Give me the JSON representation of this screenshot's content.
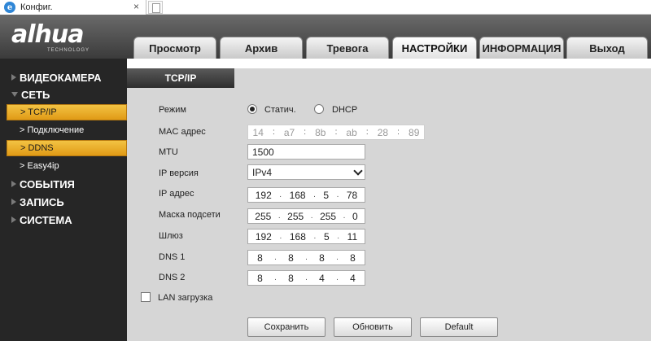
{
  "browser": {
    "tab_title": "Конфиг.",
    "close_glyph": "×"
  },
  "header": {
    "logo": "alhua",
    "logo_sub": "TECHNOLOGY",
    "tabs": [
      "Просмотр",
      "Архив",
      "Тревога",
      "НАСТРОЙКИ",
      "ИНФОРМАЦИЯ",
      "Выход"
    ],
    "active_tab": "НАСТРОЙКИ"
  },
  "sidebar": {
    "items": [
      {
        "label": "ВИДЕОКАМЕРА"
      },
      {
        "label": "СЕТЬ"
      },
      {
        "label": "> TCP/IP"
      },
      {
        "label": "> Подключение"
      },
      {
        "label": "> DDNS"
      },
      {
        "label": "> Easy4ip"
      },
      {
        "label": "СОБЫТИЯ"
      },
      {
        "label": "ЗАПИСЬ"
      },
      {
        "label": "СИСТЕМА"
      }
    ]
  },
  "content": {
    "tab": "TCP/IP",
    "mode": {
      "label": "Режим",
      "static": "Статич.",
      "dhcp": "DHCP",
      "selected": "static"
    },
    "mac": {
      "label": "MAC адрес",
      "octets": [
        "14",
        "a7",
        "8b",
        "ab",
        "28",
        "89"
      ]
    },
    "mtu": {
      "label": "MTU",
      "value": "1500"
    },
    "ip_version": {
      "label": "IP версия",
      "value": "IPv4"
    },
    "ip": {
      "label": "IP адрес",
      "octets": [
        "192",
        "168",
        "5",
        "78"
      ]
    },
    "mask": {
      "label": "Маска подсети",
      "octets": [
        "255",
        "255",
        "255",
        "0"
      ]
    },
    "gateway": {
      "label": "Шлюз",
      "octets": [
        "192",
        "168",
        "5",
        "11"
      ]
    },
    "dns1": {
      "label": "DNS 1",
      "octets": [
        "8",
        "8",
        "8",
        "8"
      ]
    },
    "dns2": {
      "label": "DNS 2",
      "octets": [
        "8",
        "8",
        "4",
        "4"
      ]
    },
    "lan_download": {
      "label": "LAN загрузка",
      "checked": false
    },
    "buttons": {
      "save": "Сохранить",
      "refresh": "Обновить",
      "default": "Default"
    }
  },
  "colors": {
    "sidebar_bg": "#262626",
    "highlight": "#f0b432",
    "content_bg": "#d6d6d6"
  }
}
